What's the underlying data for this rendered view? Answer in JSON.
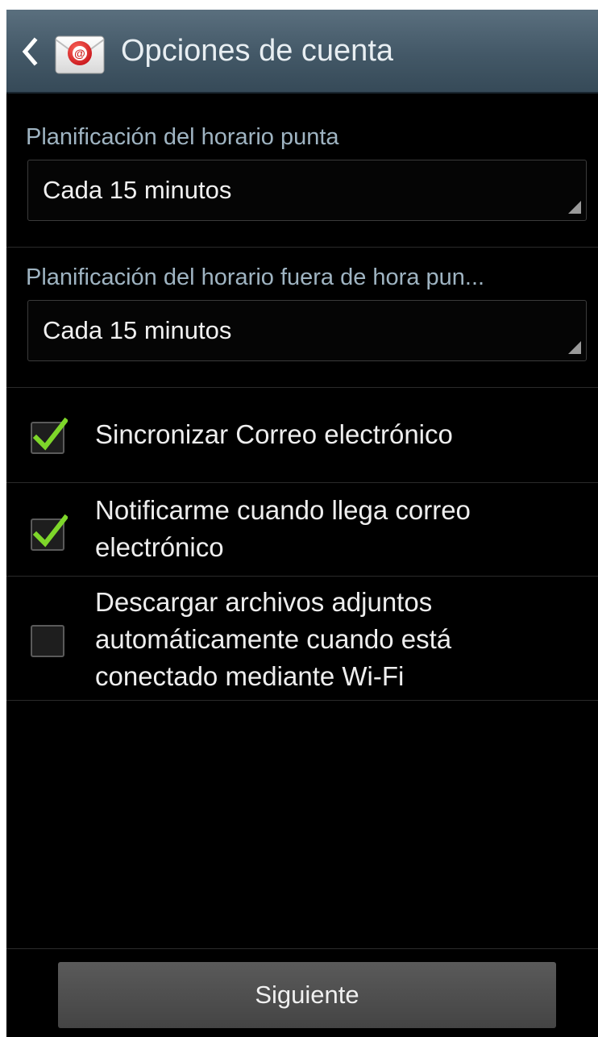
{
  "action_bar": {
    "title": "Opciones de cuenta",
    "back_icon": "chevron-left-icon",
    "app_icon": "email-at-icon"
  },
  "peak_schedule": {
    "label": "Planificación del horario punta",
    "value": "Cada 15 minutos"
  },
  "offpeak_schedule": {
    "label": "Planificación del horario fuera de hora pun...",
    "value": "Cada 15 minutos"
  },
  "options": [
    {
      "label": "Sincronizar Correo electrónico",
      "checked": true
    },
    {
      "label_line1": "Notificarme cuando llega correo",
      "label_line2": "electrónico",
      "checked": true
    },
    {
      "label_line1": "Descargar archivos adjuntos",
      "label_line2": "automáticamente cuando está",
      "label_line3": "conectado mediante Wi-Fi",
      "checked": false
    }
  ],
  "footer": {
    "next_label": "Siguiente"
  },
  "colors": {
    "action_bar": "#435867",
    "section_label": "#9fb4c2",
    "check_mark": "#7ed62a",
    "background": "#000000",
    "button": "#4f4f4f"
  }
}
